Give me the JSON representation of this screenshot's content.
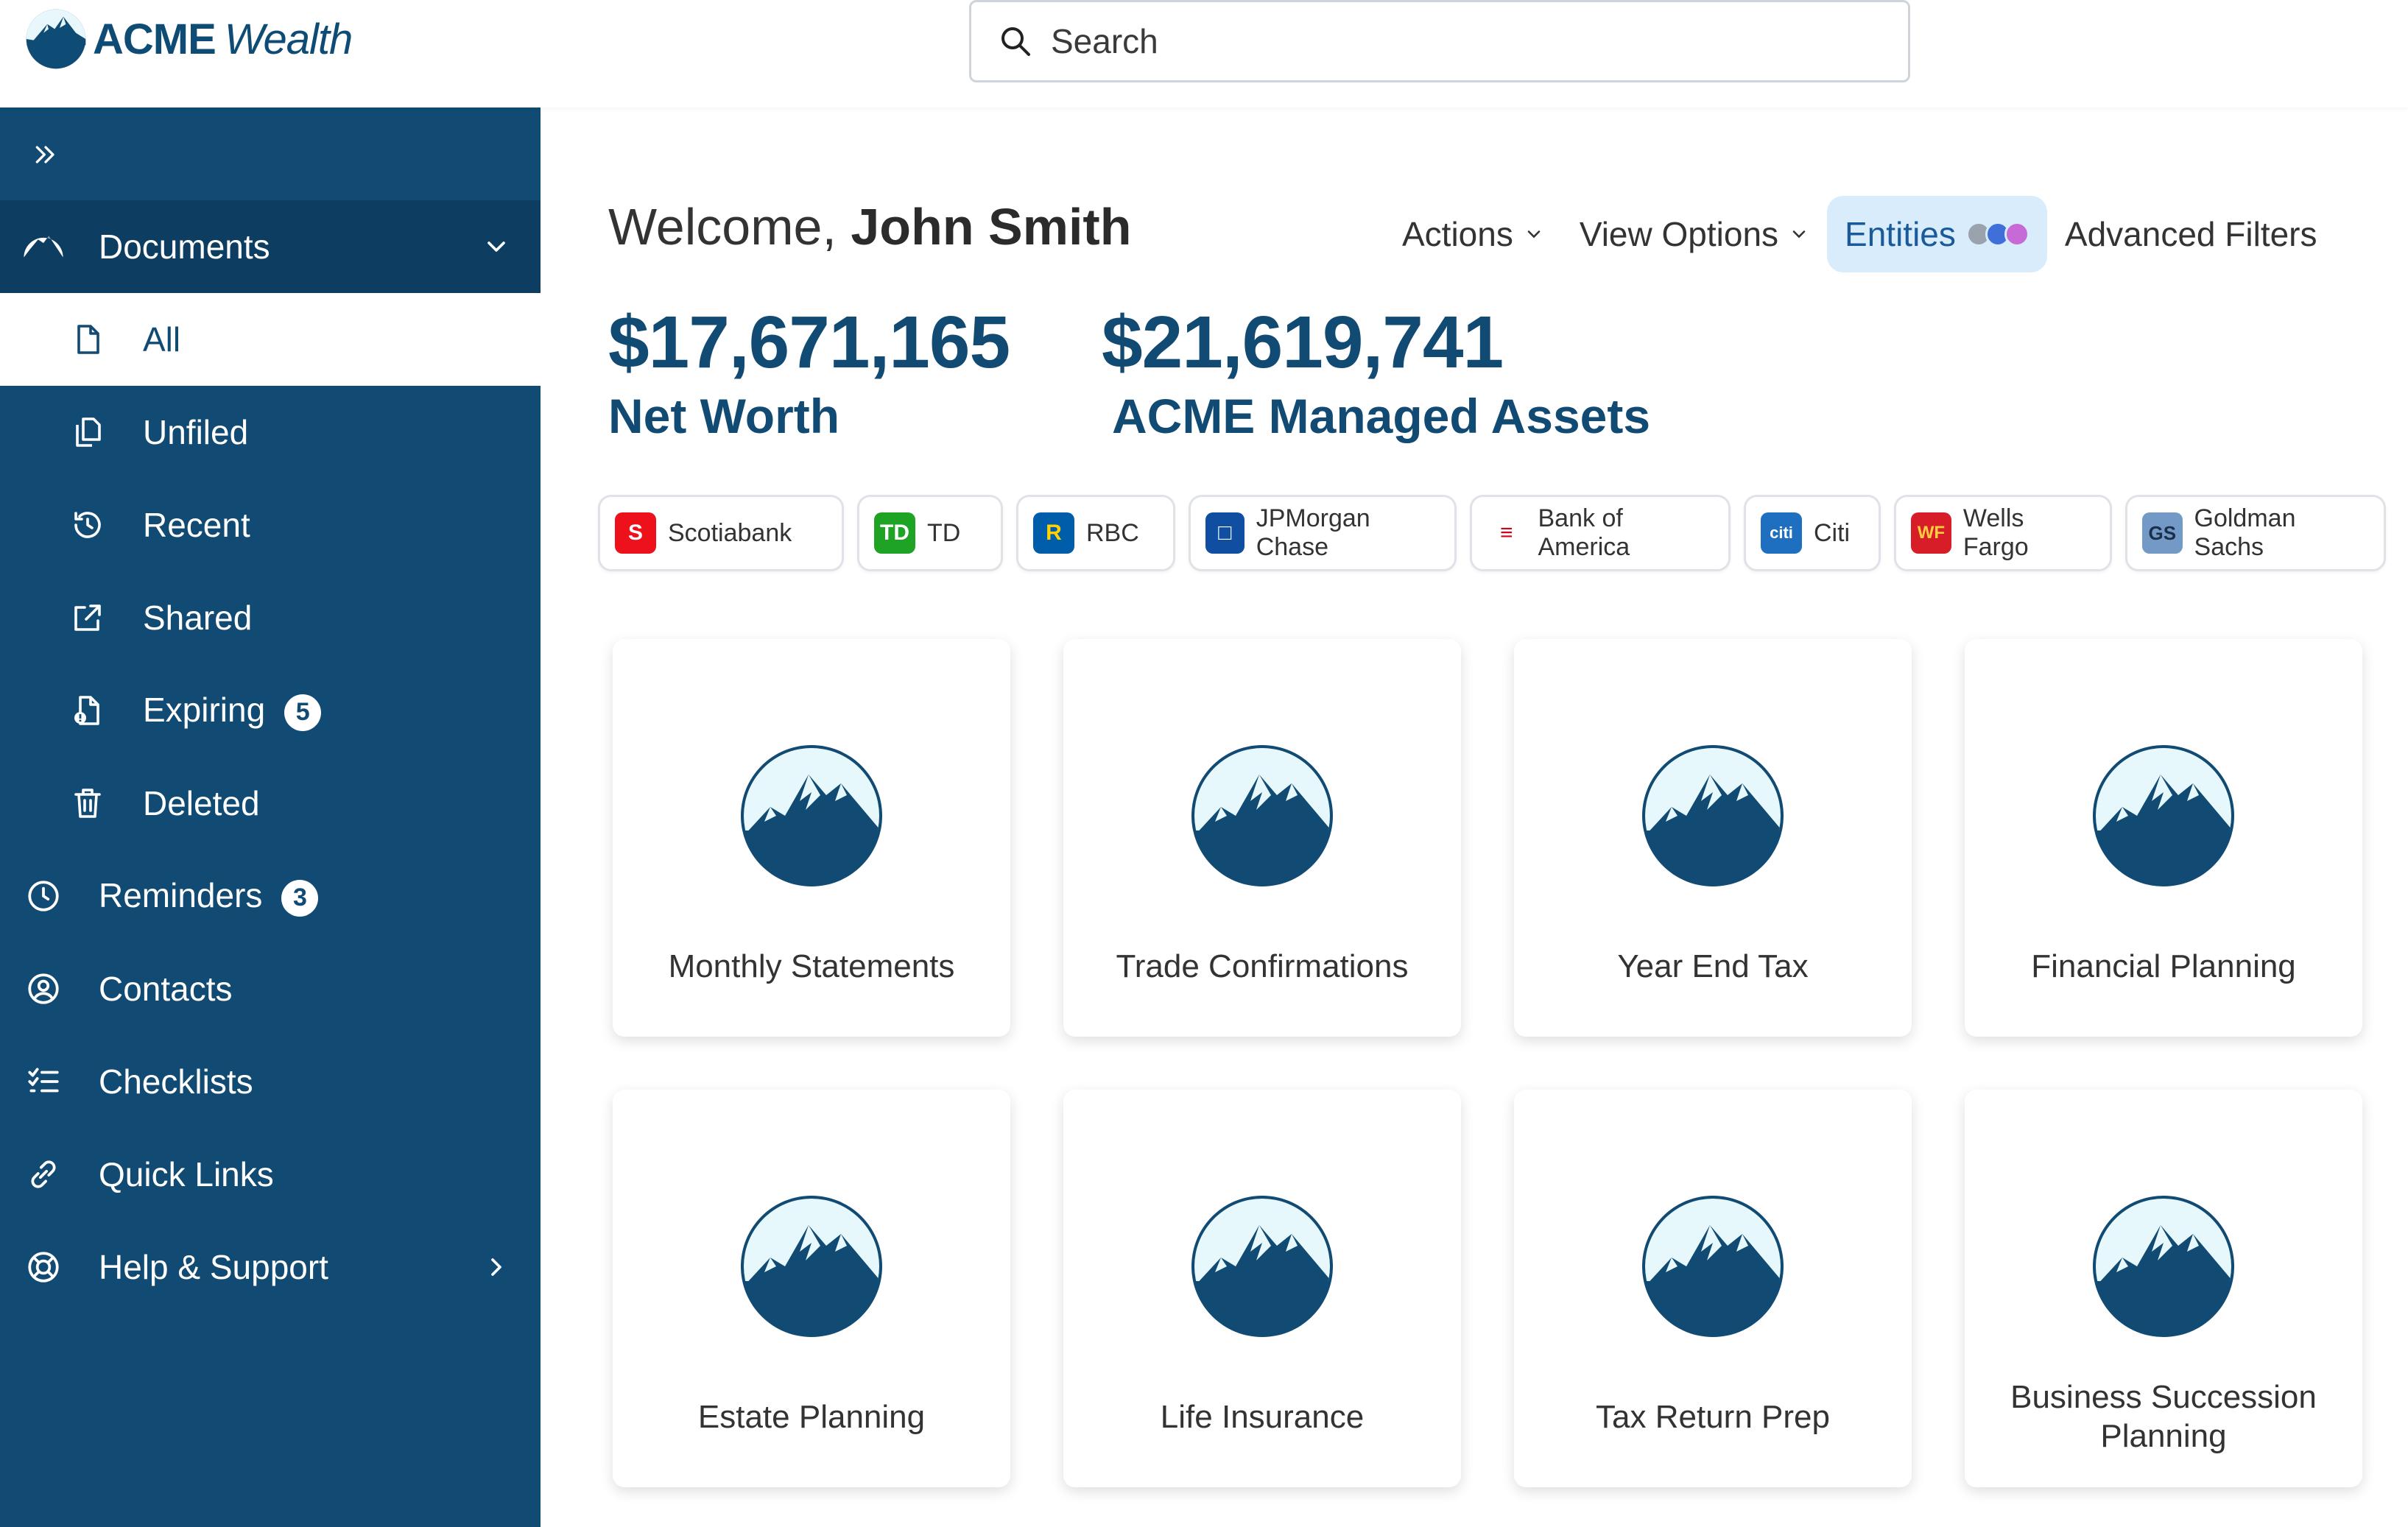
{
  "brand": {
    "name": "ACME",
    "sub": "Wealth"
  },
  "search": {
    "placeholder": "Search"
  },
  "sidebar": {
    "documents": "Documents",
    "sub": [
      {
        "label": "All",
        "icon": "file-icon"
      },
      {
        "label": "Unfiled",
        "icon": "copy-icon"
      },
      {
        "label": "Recent",
        "icon": "history-icon"
      },
      {
        "label": "Shared",
        "icon": "share-icon"
      },
      {
        "label": "Expiring",
        "icon": "file-alert-icon",
        "badge": "5"
      },
      {
        "label": "Deleted",
        "icon": "trash-icon"
      }
    ],
    "reminders": "Reminders",
    "reminders_badge": "3",
    "contacts": "Contacts",
    "checklists": "Checklists",
    "quick_links": "Quick Links",
    "help": "Help & Support"
  },
  "welcome": {
    "prefix": "Welcome,",
    "name": "John Smith"
  },
  "toolbar": {
    "actions": "Actions",
    "view_options": "View Options",
    "entities": "Entities",
    "advanced_filters": "Advanced Filters"
  },
  "stats": {
    "net_worth_value": "$17,671,165",
    "net_worth_label": "Net Worth",
    "managed_value": "$21,619,741",
    "managed_label": "ACME Managed Assets"
  },
  "banks": [
    "Scotiabank",
    "TD",
    "RBC",
    "JPMorgan Chase",
    "Bank of America",
    "Citi",
    "Wells Fargo",
    "Goldman Sachs"
  ],
  "cards": [
    "Monthly Statements",
    "Trade Confirmations",
    "Year End Tax",
    "Financial Planning",
    "Estate Planning",
    "Life Insurance",
    "Tax Return Prep",
    "Business Succession Planning"
  ],
  "colors": {
    "sidebar": "#114a72",
    "accent": "#114a72",
    "entities_bg": "#d8ecfb"
  }
}
